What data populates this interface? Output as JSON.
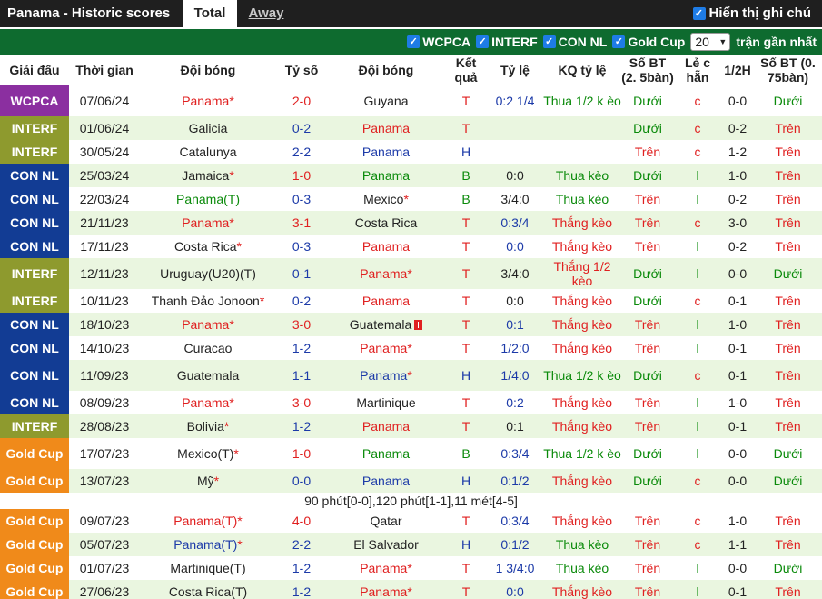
{
  "tabs": {
    "title": "Panama - Historic scores",
    "total": "Total",
    "away": "Away"
  },
  "show_all": "Hiển thị ghi chú",
  "filters": [
    "WCPCA",
    "INTERF",
    "CON NL",
    "Gold Cup"
  ],
  "recent": {
    "count": "20",
    "label": "trận gần nhất"
  },
  "headers": {
    "league": "Giải đấu",
    "date": "Thời gian",
    "home": "Đội bóng",
    "score": "Tỷ số",
    "away": "Đội bóng",
    "result": "Kết quả",
    "odds": "Tỷ lệ",
    "odds_result": "KQ tỷ lệ",
    "ou": "Số BT (2. 5bàn)",
    "oddeven": "Lẻ c hẵn",
    "half": "1/2H",
    "ou2": "Số BT (0. 75bàn)"
  },
  "colors": {
    "WCPCA": "#8b2fa0",
    "INTERF": "#8e9a2e",
    "CON NL": "#123c94",
    "Gold Cup": "#f08a1a",
    "header_green": "#0e6b2f"
  },
  "note": "90 phút[0-0],120 phút[1-1],11 mét[4-5]",
  "rows": [
    {
      "league": "WCPCA",
      "date": "07/06/24",
      "home": "Panama",
      "home_star": "*",
      "home_c": "red",
      "score": "2-0",
      "score_c": "red",
      "away": "Guyana",
      "away_star": "",
      "away_c": "dark",
      "res": "T",
      "res_c": "red",
      "odds": "0:2 1/4",
      "odds_c": "blue",
      "kq": "Thua 1/2 k èo",
      "kq_c": "green",
      "ou": "Dưới",
      "ou_c": "green",
      "oe": "c",
      "oe_c": "red",
      "half": "0-0",
      "ou2": "Dưới",
      "ou2_c": "green",
      "tall": true
    },
    {
      "league": "INTERF",
      "date": "01/06/24",
      "home": "Galicia",
      "home_star": "",
      "home_c": "dark",
      "score": "0-2",
      "score_c": "blue",
      "away": "Panama",
      "away_star": "",
      "away_c": "red",
      "res": "T",
      "res_c": "red",
      "odds": "",
      "odds_c": "blue",
      "kq": "",
      "kq_c": "green",
      "ou": "Dưới",
      "ou_c": "green",
      "oe": "c",
      "oe_c": "red",
      "half": "0-2",
      "ou2": "Trên",
      "ou2_c": "red"
    },
    {
      "league": "INTERF",
      "date": "30/05/24",
      "home": "Catalunya",
      "home_star": "",
      "home_c": "dark",
      "score": "2-2",
      "score_c": "blue",
      "away": "Panama",
      "away_star": "",
      "away_c": "blue",
      "res": "H",
      "res_c": "blue",
      "odds": "",
      "odds_c": "blue",
      "kq": "",
      "kq_c": "green",
      "ou": "Trên",
      "ou_c": "red",
      "oe": "c",
      "oe_c": "red",
      "half": "1-2",
      "ou2": "Trên",
      "ou2_c": "red"
    },
    {
      "league": "CON NL",
      "date": "25/03/24",
      "home": "Jamaica",
      "home_star": "*",
      "home_c": "dark",
      "score": "1-0",
      "score_c": "red",
      "away": "Panama",
      "away_star": "",
      "away_c": "green",
      "res": "B",
      "res_c": "green",
      "odds": "0:0",
      "odds_c": "dark",
      "kq": "Thua kèo",
      "kq_c": "green",
      "ou": "Dưới",
      "ou_c": "green",
      "oe": "l",
      "oe_c": "green",
      "half": "1-0",
      "ou2": "Trên",
      "ou2_c": "red"
    },
    {
      "league": "CON NL",
      "date": "22/03/24",
      "home": "Panama(T)",
      "home_star": "",
      "home_c": "green",
      "score": "0-3",
      "score_c": "blue",
      "away": "Mexico",
      "away_star": "*",
      "away_c": "dark",
      "res": "B",
      "res_c": "green",
      "odds": "3/4:0",
      "odds_c": "dark",
      "kq": "Thua kèo",
      "kq_c": "green",
      "ou": "Trên",
      "ou_c": "red",
      "oe": "l",
      "oe_c": "green",
      "half": "0-2",
      "ou2": "Trên",
      "ou2_c": "red"
    },
    {
      "league": "CON NL",
      "date": "21/11/23",
      "home": "Panama",
      "home_star": "*",
      "home_c": "red",
      "score": "3-1",
      "score_c": "red",
      "away": "Costa Rica",
      "away_star": "",
      "away_c": "dark",
      "res": "T",
      "res_c": "red",
      "odds": "0:3/4",
      "odds_c": "blue",
      "kq": "Thắng kèo",
      "kq_c": "red",
      "ou": "Trên",
      "ou_c": "red",
      "oe": "c",
      "oe_c": "red",
      "half": "3-0",
      "ou2": "Trên",
      "ou2_c": "red"
    },
    {
      "league": "CON NL",
      "date": "17/11/23",
      "home": "Costa Rica",
      "home_star": "*",
      "home_c": "dark",
      "score": "0-3",
      "score_c": "blue",
      "away": "Panama",
      "away_star": "",
      "away_c": "red",
      "res": "T",
      "res_c": "red",
      "odds": "0:0",
      "odds_c": "blue",
      "kq": "Thắng kèo",
      "kq_c": "red",
      "ou": "Trên",
      "ou_c": "red",
      "oe": "l",
      "oe_c": "green",
      "half": "0-2",
      "ou2": "Trên",
      "ou2_c": "red"
    },
    {
      "league": "INTERF",
      "date": "12/11/23",
      "home": "Uruguay(U20)(T)",
      "home_star": "",
      "home_c": "dark",
      "score": "0-1",
      "score_c": "blue",
      "away": "Panama",
      "away_star": "*",
      "away_c": "red",
      "res": "T",
      "res_c": "red",
      "odds": "3/4:0",
      "odds_c": "dark",
      "kq": "Thắng 1/2 kèo",
      "kq_c": "red",
      "ou": "Dưới",
      "ou_c": "green",
      "oe": "l",
      "oe_c": "green",
      "half": "0-0",
      "ou2": "Dưới",
      "ou2_c": "green",
      "tall": true
    },
    {
      "league": "INTERF",
      "date": "10/11/23",
      "home": "Thanh Đảo Jonoon",
      "home_star": "*",
      "home_c": "dark",
      "score": "0-2",
      "score_c": "blue",
      "away": "Panama",
      "away_star": "",
      "away_c": "red",
      "res": "T",
      "res_c": "red",
      "odds": "0:0",
      "odds_c": "dark",
      "kq": "Thắng kèo",
      "kq_c": "red",
      "ou": "Dưới",
      "ou_c": "green",
      "oe": "c",
      "oe_c": "red",
      "half": "0-1",
      "ou2": "Trên",
      "ou2_c": "red"
    },
    {
      "league": "CON NL",
      "date": "18/10/23",
      "home": "Panama",
      "home_star": "*",
      "home_c": "red",
      "score": "3-0",
      "score_c": "red",
      "away": "Guatemala",
      "away_star": "",
      "away_c": "dark",
      "res": "T",
      "res_c": "red",
      "odds": "0:1",
      "odds_c": "blue",
      "kq": "Thắng kèo",
      "kq_c": "red",
      "ou": "Trên",
      "ou_c": "red",
      "oe": "l",
      "oe_c": "green",
      "half": "1-0",
      "ou2": "Trên",
      "ou2_c": "red",
      "flag": true
    },
    {
      "league": "CON NL",
      "date": "14/10/23",
      "home": "Curacao",
      "home_star": "",
      "home_c": "dark",
      "score": "1-2",
      "score_c": "blue",
      "away": "Panama",
      "away_star": "*",
      "away_c": "red",
      "res": "T",
      "res_c": "red",
      "odds": "1/2:0",
      "odds_c": "blue",
      "kq": "Thắng kèo",
      "kq_c": "red",
      "ou": "Trên",
      "ou_c": "red",
      "oe": "l",
      "oe_c": "green",
      "half": "0-1",
      "ou2": "Trên",
      "ou2_c": "red"
    },
    {
      "league": "CON NL",
      "date": "11/09/23",
      "home": "Guatemala",
      "home_star": "",
      "home_c": "dark",
      "score": "1-1",
      "score_c": "blue",
      "away": "Panama",
      "away_star": "*",
      "away_c": "blue",
      "res": "H",
      "res_c": "blue",
      "odds": "1/4:0",
      "odds_c": "blue",
      "kq": "Thua 1/2 k èo",
      "kq_c": "green",
      "ou": "Dưới",
      "ou_c": "green",
      "oe": "c",
      "oe_c": "red",
      "half": "0-1",
      "ou2": "Trên",
      "ou2_c": "red",
      "tall": true
    },
    {
      "league": "CON NL",
      "date": "08/09/23",
      "home": "Panama",
      "home_star": "*",
      "home_c": "red",
      "score": "3-0",
      "score_c": "red",
      "away": "Martinique",
      "away_star": "",
      "away_c": "dark",
      "res": "T",
      "res_c": "red",
      "odds": "0:2",
      "odds_c": "blue",
      "kq": "Thắng kèo",
      "kq_c": "red",
      "ou": "Trên",
      "ou_c": "red",
      "oe": "l",
      "oe_c": "green",
      "half": "1-0",
      "ou2": "Trên",
      "ou2_c": "red"
    },
    {
      "league": "INTERF",
      "date": "28/08/23",
      "home": "Bolivia",
      "home_star": "*",
      "home_c": "dark",
      "score": "1-2",
      "score_c": "blue",
      "away": "Panama",
      "away_star": "",
      "away_c": "red",
      "res": "T",
      "res_c": "red",
      "odds": "0:1",
      "odds_c": "dark",
      "kq": "Thắng kèo",
      "kq_c": "red",
      "ou": "Trên",
      "ou_c": "red",
      "oe": "l",
      "oe_c": "green",
      "half": "0-1",
      "ou2": "Trên",
      "ou2_c": "red"
    },
    {
      "league": "Gold Cup",
      "date": "17/07/23",
      "home": "Mexico(T)",
      "home_star": "*",
      "home_c": "dark",
      "score": "1-0",
      "score_c": "red",
      "away": "Panama",
      "away_star": "",
      "away_c": "green",
      "res": "B",
      "res_c": "green",
      "odds": "0:3/4",
      "odds_c": "blue",
      "kq": "Thua 1/2 k èo",
      "kq_c": "green",
      "ou": "Dưới",
      "ou_c": "green",
      "oe": "l",
      "oe_c": "green",
      "half": "0-0",
      "ou2": "Dưới",
      "ou2_c": "green",
      "tall": true
    },
    {
      "league": "Gold Cup",
      "date": "13/07/23",
      "home": "Mỹ",
      "home_star": "*",
      "home_c": "dark",
      "score": "0-0",
      "score_c": "blue",
      "away": "Panama",
      "away_star": "",
      "away_c": "blue",
      "res": "H",
      "res_c": "blue",
      "odds": "0:1/2",
      "odds_c": "blue",
      "kq": "Thắng kèo",
      "kq_c": "red",
      "ou": "Dưới",
      "ou_c": "green",
      "oe": "c",
      "oe_c": "red",
      "half": "0-0",
      "ou2": "Dưới",
      "ou2_c": "green",
      "note": true
    },
    {
      "league": "Gold Cup",
      "date": "09/07/23",
      "home": "Panama(T)",
      "home_star": "*",
      "home_c": "red",
      "score": "4-0",
      "score_c": "red",
      "away": "Qatar",
      "away_star": "",
      "away_c": "dark",
      "res": "T",
      "res_c": "red",
      "odds": "0:3/4",
      "odds_c": "blue",
      "kq": "Thắng kèo",
      "kq_c": "red",
      "ou": "Trên",
      "ou_c": "red",
      "oe": "c",
      "oe_c": "red",
      "half": "1-0",
      "ou2": "Trên",
      "ou2_c": "red"
    },
    {
      "league": "Gold Cup",
      "date": "05/07/23",
      "home": "Panama(T)",
      "home_star": "*",
      "home_c": "blue",
      "score": "2-2",
      "score_c": "blue",
      "away": "El Salvador",
      "away_star": "",
      "away_c": "dark",
      "res": "H",
      "res_c": "blue",
      "odds": "0:1/2",
      "odds_c": "blue",
      "kq": "Thua kèo",
      "kq_c": "green",
      "ou": "Trên",
      "ou_c": "red",
      "oe": "c",
      "oe_c": "red",
      "half": "1-1",
      "ou2": "Trên",
      "ou2_c": "red"
    },
    {
      "league": "Gold Cup",
      "date": "01/07/23",
      "home": "Martinique(T)",
      "home_star": "",
      "home_c": "dark",
      "score": "1-2",
      "score_c": "blue",
      "away": "Panama",
      "away_star": "*",
      "away_c": "red",
      "res": "T",
      "res_c": "red",
      "odds": "1 3/4:0",
      "odds_c": "blue",
      "kq": "Thua kèo",
      "kq_c": "green",
      "ou": "Trên",
      "ou_c": "red",
      "oe": "l",
      "oe_c": "green",
      "half": "0-0",
      "ou2": "Dưới",
      "ou2_c": "green"
    },
    {
      "league": "Gold Cup",
      "date": "27/06/23",
      "home": "Costa Rica(T)",
      "home_star": "",
      "home_c": "dark",
      "score": "1-2",
      "score_c": "blue",
      "away": "Panama",
      "away_star": "*",
      "away_c": "red",
      "res": "T",
      "res_c": "red",
      "odds": "0:0",
      "odds_c": "blue",
      "kq": "Thắng kèo",
      "kq_c": "red",
      "ou": "Trên",
      "ou_c": "red",
      "oe": "l",
      "oe_c": "green",
      "half": "0-1",
      "ou2": "Trên",
      "ou2_c": "red"
    }
  ]
}
